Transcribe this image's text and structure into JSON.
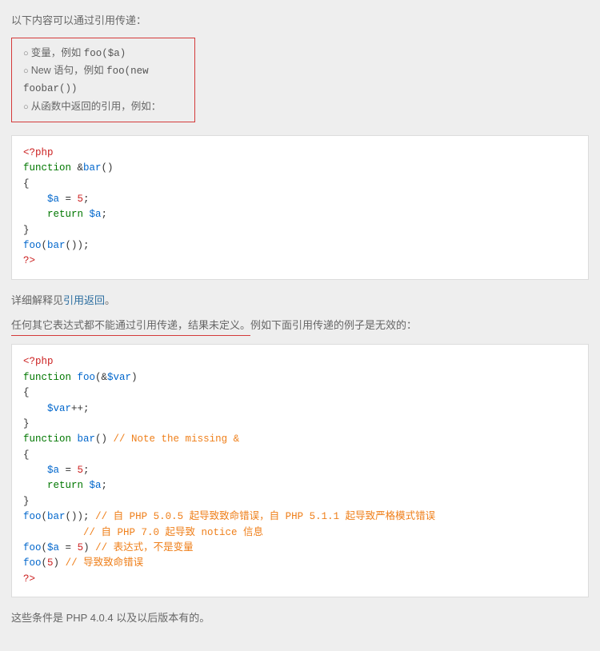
{
  "intro": "以下内容可以通过引用传递：",
  "bullets": {
    "b1_text": "变量，例如 ",
    "b1_code": "foo($a)",
    "b2_text": "New 语句，例如 ",
    "b2_code": "foo(new foobar())",
    "b3_text": "从函数中返回的引用，例如："
  },
  "code1": {
    "l1a": "<?php",
    "l2a": "function ",
    "l2b": "&",
    "l2c": "bar",
    "l2d": "()",
    "l3": "{",
    "l4a": "    $a ",
    "l4b": "= ",
    "l4c": "5",
    "l4d": ";",
    "l5a": "    return ",
    "l5b": "$a",
    "l5c": ";",
    "l6": "}",
    "l7a": "foo",
    "l7b": "(",
    "l7c": "bar",
    "l7d": "());",
    "l8": "?>"
  },
  "explain": {
    "prefix": "详细解释见",
    "link": "引用返回",
    "suffix": "。"
  },
  "invalid_sentence": {
    "u": "任何其它表达式都不能通过引用传递，结果未定义。",
    "rest": "例如下面引用传递的例子是无效的："
  },
  "code2": {
    "l1": "<?php",
    "l2a": "function ",
    "l2b": "foo",
    "l2c": "(&",
    "l2d": "$var",
    "l2e": ")",
    "l3": "{",
    "l4a": "    $var",
    "l4b": "++;",
    "l5": "}",
    "l6a": "function ",
    "l6b": "bar",
    "l6c": "() ",
    "l6d": "// Note the missing &",
    "l7": "{",
    "l8a": "    $a ",
    "l8b": "= ",
    "l8c": "5",
    "l8d": ";",
    "l9a": "    return ",
    "l9b": "$a",
    "l9c": ";",
    "l10": "}",
    "l11a": "foo",
    "l11b": "(",
    "l11c": "bar",
    "l11d": "()); ",
    "l11e": "// 自 PHP 5.0.5 起导致致命错误，自 PHP 5.1.1 起导致严格模式错误",
    "l12a": "          ",
    "l12b": "// 自 PHP 7.0 起导致 notice 信息",
    "l13a": "foo",
    "l13b": "(",
    "l13c": "$a ",
    "l13d": "= ",
    "l13e": "5",
    "l13f": ") ",
    "l13g": "// 表达式，不是变量",
    "l14a": "foo",
    "l14b": "(",
    "l14c": "5",
    "l14d": ") ",
    "l14e": "// 导致致命错误",
    "l15": "?>"
  },
  "footer": "这些条件是 PHP 4.0.4 以及以后版本有的。"
}
